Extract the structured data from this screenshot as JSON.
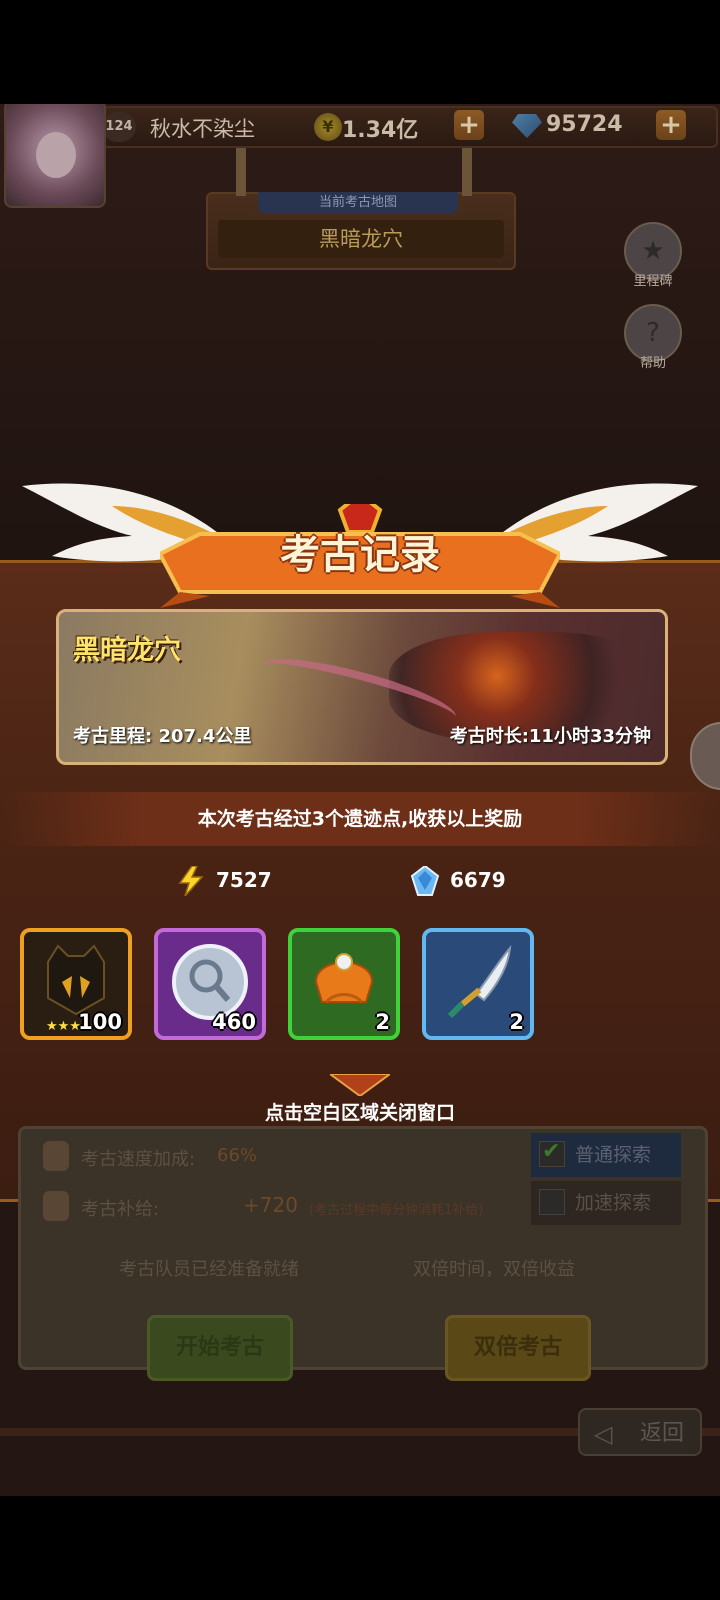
{
  "player": {
    "level": "124",
    "name": "秋水不染尘",
    "gold": "1.34亿",
    "diamonds": "95724"
  },
  "current_map": {
    "label": "当前考古地图",
    "name": "黑暗龙穴"
  },
  "side_buttons": {
    "milestone": "里程碑",
    "help": "帮助"
  },
  "record": {
    "title": "考古记录",
    "map_name": "黑暗龙穴",
    "distance": "考古里程: 207.4公里",
    "duration": "考古时长:11小时33分钟",
    "summary": "本次考古经过3个遗迹点,收获以上奖励",
    "resources": [
      {
        "icon": "lightning-icon",
        "value": "7527"
      },
      {
        "icon": "crystal-icon",
        "value": "6679"
      }
    ],
    "items": [
      {
        "icon": "hero-soul-icon",
        "count": "100",
        "stars": "★★★★",
        "border": "#f0a020",
        "bg": "#2a1e12"
      },
      {
        "icon": "magnifier-icon",
        "count": "460",
        "border": "#c46ad8",
        "bg": "#6a2c8a"
      },
      {
        "icon": "turban-icon",
        "count": "2",
        "border": "#3fd23a",
        "bg": "#2f6a22"
      },
      {
        "icon": "dagger-icon",
        "count": "2",
        "border": "#62b8f0",
        "bg": "#2a4a7a"
      }
    ],
    "close_hint": "点击空白区域关闭窗口"
  },
  "expedition": {
    "speed_label": "考古速度加成:",
    "speed_value": "66%",
    "supply_label": "考古补给:",
    "supply_value": "+720",
    "supply_note": "(考古过程中每分钟消耗1补给)",
    "tab_normal": "普通探索",
    "tab_fast": "加速探索",
    "ready_text": "考古队员已经准备就绪",
    "double_text": "双倍时间，双倍收益",
    "start_button": "开始考古",
    "double_button": "双倍考古"
  },
  "back_label": "返回"
}
